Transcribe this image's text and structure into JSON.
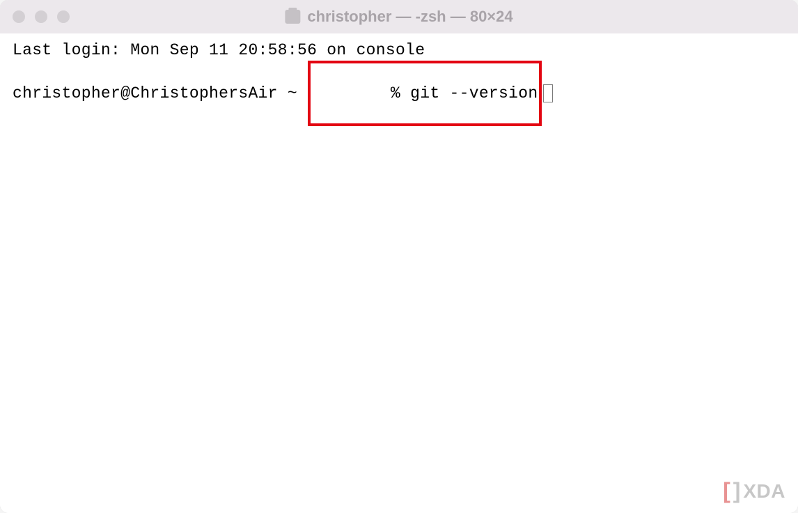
{
  "window": {
    "title": "christopher — -zsh — 80×24"
  },
  "terminal": {
    "last_login": "Last login: Mon Sep 11 20:58:56 on console",
    "prompt_user_host": "christopher@ChristophersAir ~ ",
    "highlighted_command": "% git --version"
  },
  "watermark": {
    "text": "XDA"
  }
}
